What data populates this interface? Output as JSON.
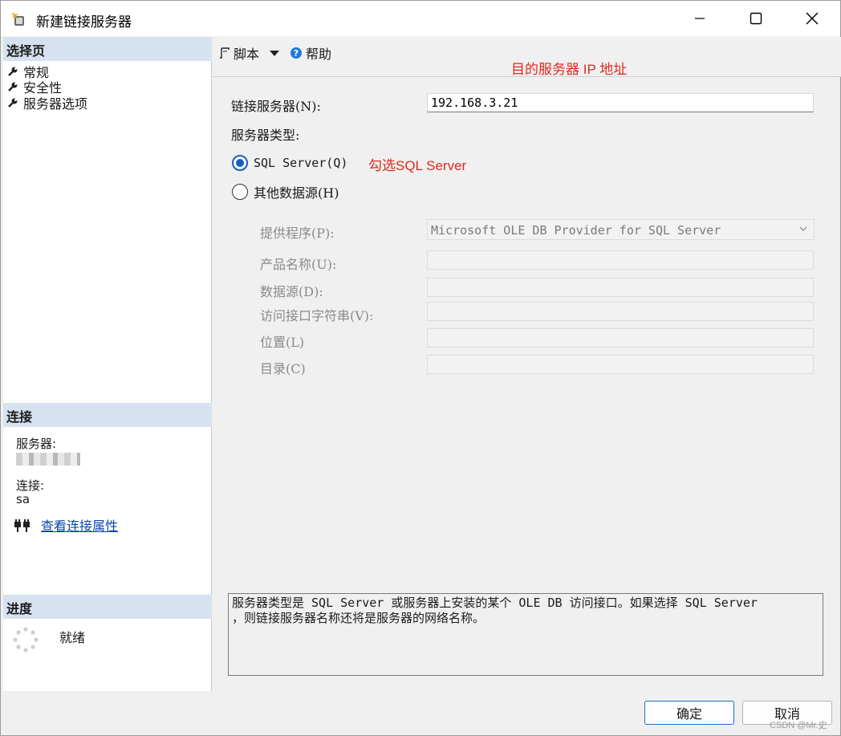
{
  "window": {
    "title": "新建链接服务器"
  },
  "left_panel": {
    "select_page_header": "选择页",
    "nav_items": [
      "常规",
      "安全性",
      "服务器选项"
    ],
    "connection_header": "连接",
    "server_label": "服务器:",
    "connection_label": "连接:",
    "connection_value": "sa",
    "view_properties_link": "查看连接属性",
    "progress_header": "进度",
    "progress_status": "就绪"
  },
  "toolbar": {
    "script_label": "脚本",
    "help_label": "帮助"
  },
  "annotations": {
    "target_ip": "目的服务器 IP 地址",
    "select_sql": "勾选SQL Server",
    "color": "#e0281e"
  },
  "form": {
    "linked_server_label": "链接服务器(N):",
    "linked_server_value": "192.168.3.21",
    "server_type_label": "服务器类型:",
    "radio_sql_server": "SQL Server(Q)",
    "radio_other": "其他数据源(H)",
    "selected_radio": "sql_server",
    "provider_label": "提供程序(P):",
    "provider_value": "Microsoft OLE DB Provider for SQL Server",
    "product_name_label": "产品名称(U):",
    "data_source_label": "数据源(D):",
    "provider_string_label": "访问接口字符串(V):",
    "location_label": "位置(L)",
    "catalog_label": "目录(C)"
  },
  "description": "服务器类型是 SQL Server 或服务器上安装的某个 OLE DB 访问接口。如果选择 SQL Server\n，则链接服务器名称还将是服务器的网络名称。",
  "buttons": {
    "ok": "确定",
    "cancel": "取消"
  },
  "watermark": "CSDN @Mr.史",
  "colors": {
    "accent": "#1560bd",
    "section_header": "#d6e2ef",
    "link": "#0645ad"
  }
}
